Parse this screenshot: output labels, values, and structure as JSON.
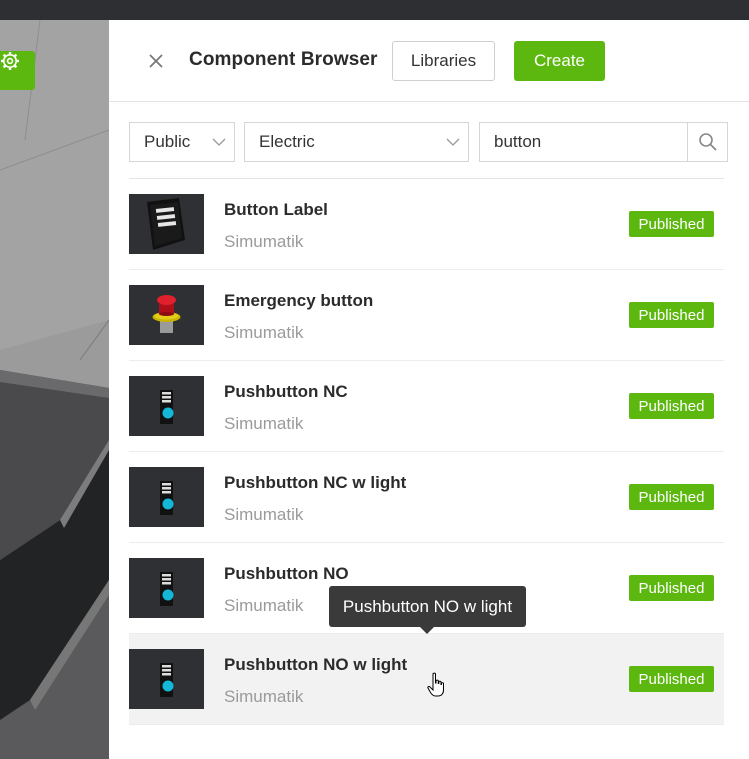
{
  "header": {
    "title": "Component Browser",
    "libraries_label": "Libraries",
    "create_label": "Create"
  },
  "filters": {
    "visibility": "Public",
    "category": "Electric"
  },
  "search": {
    "value": "button"
  },
  "components": [
    {
      "name": "Button Label",
      "author": "Simumatik",
      "status": "Published",
      "thumbnail": "button-label-thumbnail"
    },
    {
      "name": "Emergency button",
      "author": "Simumatik",
      "status": "Published",
      "thumbnail": "emergency-button-thumbnail"
    },
    {
      "name": "Pushbutton NC",
      "author": "Simumatik",
      "status": "Published",
      "thumbnail": "pushbutton-thumbnail"
    },
    {
      "name": "Pushbutton NC w light",
      "author": "Simumatik",
      "status": "Published",
      "thumbnail": "pushbutton-thumbnail"
    },
    {
      "name": "Pushbutton NO",
      "author": "Simumatik",
      "status": "Published",
      "thumbnail": "pushbutton-thumbnail"
    },
    {
      "name": "Pushbutton NO w light",
      "author": "Simumatik",
      "status": "Published",
      "thumbnail": "pushbutton-thumbnail"
    }
  ],
  "tooltip": {
    "text": "Pushbutton NO w light"
  },
  "colors": {
    "accent": "#5cb80f",
    "panel_bg": "#ffffff",
    "thumb_bg": "#2f3034"
  }
}
